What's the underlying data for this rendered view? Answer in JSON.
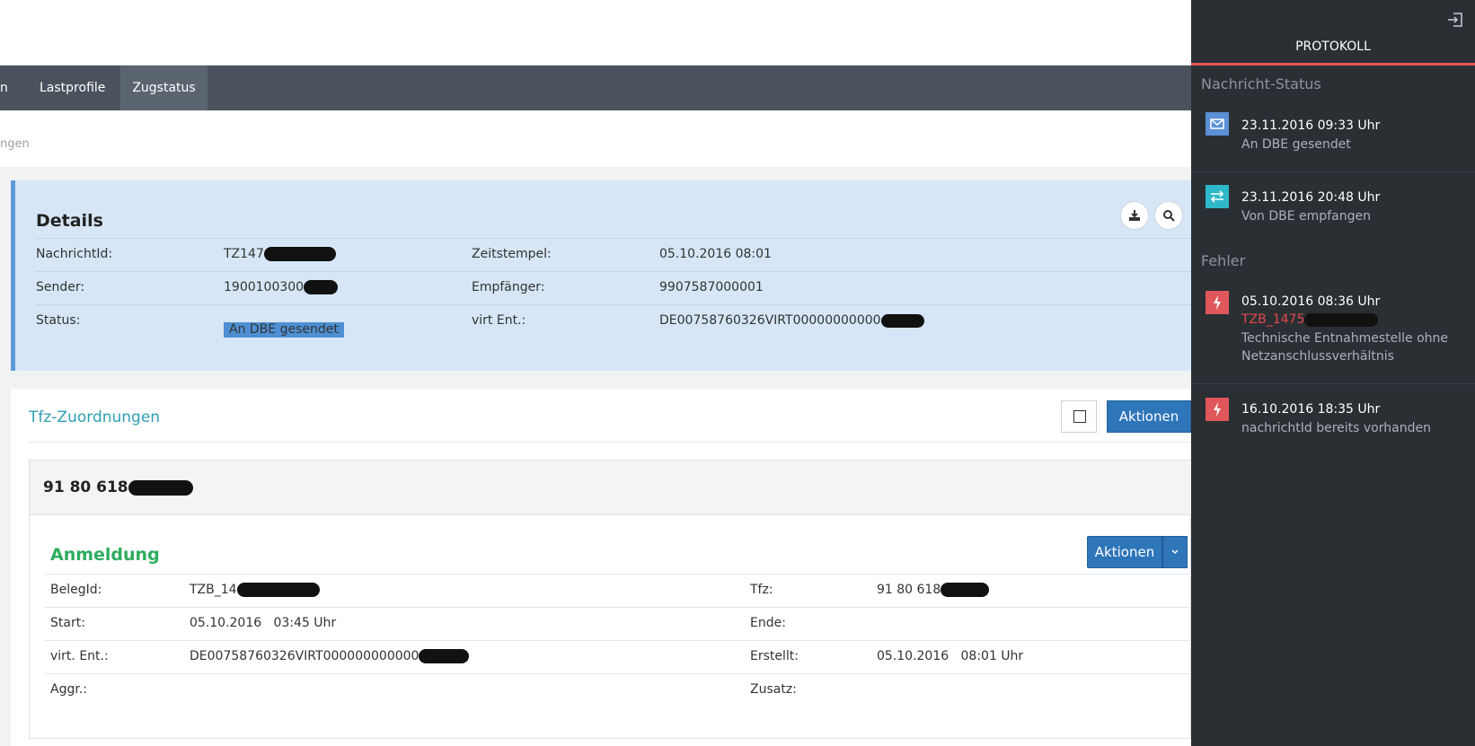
{
  "nav": {
    "items": [
      "n",
      "Lastprofile",
      "Zugstatus"
    ]
  },
  "breadcrumb": "ngen",
  "details": {
    "title": "Details",
    "nachrichtid_label": "NachrichtId:",
    "nachrichtid_value": "TZ147",
    "zeitstempel_label": "Zeitstempel:",
    "zeitstempel_value": "05.10.2016 08:01",
    "sender_label": "Sender:",
    "sender_value": "1900100300",
    "empfaenger_label": "Empfänger:",
    "empfaenger_value": "9907587000001",
    "status_label": "Status:",
    "status_value": "An DBE gesendet",
    "virt_label": "virt Ent.:",
    "virt_value": "DE00758760326VIRT00000000000"
  },
  "tfz": {
    "title": "Tfz-Zuordnungen",
    "actions_label": "Aktionen"
  },
  "train": {
    "title": "91 80 618"
  },
  "anmeldung": {
    "title": "Anmeldung",
    "actions_label": "Aktionen",
    "belegid_label": "BelegId:",
    "belegid_value": "TZB_14",
    "tfz_label": "Tfz:",
    "tfz_value": "91 80 618",
    "start_label": "Start:",
    "start_value": "05.10.2016   03:45 Uhr",
    "ende_label": "Ende:",
    "virt_label": "virt. Ent.:",
    "virt_value": "DE00758760326VIRT000000000000",
    "erstellt_label": "Erstellt:",
    "erstellt_value": "05.10.2016   08:01 Uhr",
    "aggr_label": "Aggr.:",
    "zusatz_label": "Zusatz:"
  },
  "protokoll": {
    "title": "PROTOKOLL",
    "status_section": "Nachricht-Status",
    "status_entries": [
      {
        "time": "23.11.2016 09:33 Uhr",
        "text": "An DBE gesendet",
        "icon": "envelope-icon",
        "color": "#5b8fd6"
      },
      {
        "time": "23.11.2016 20:48 Uhr",
        "text": "Von DBE empfangen",
        "icon": "exchange-icon",
        "color": "#2fb8c9"
      }
    ],
    "error_section": "Fehler",
    "error_entries": [
      {
        "time": "05.10.2016 08:36 Uhr",
        "ref": "TZB_1475",
        "text": "Technische Entnahmestelle ohne Netzanschlussverhältnis",
        "icon": "lightning-icon",
        "color": "#e0575b"
      },
      {
        "time": "16.10.2016 18:35 Uhr",
        "text": "nachrichtId bereits vorhanden",
        "icon": "lightning-icon",
        "color": "#e0575b"
      }
    ]
  }
}
